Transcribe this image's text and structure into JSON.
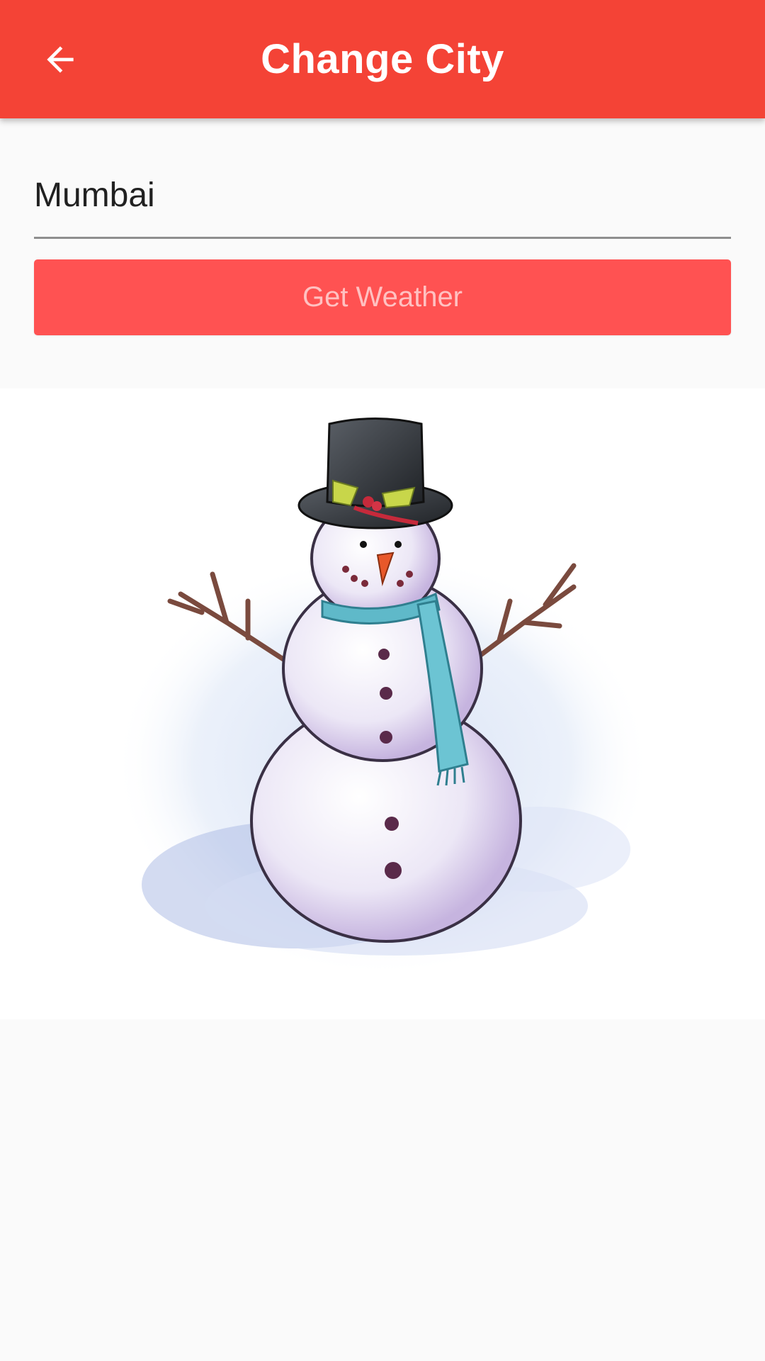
{
  "appbar": {
    "title": "Change City",
    "back_icon": "arrow-back-icon",
    "color": "#f44336"
  },
  "form": {
    "city_value": "Mumbai",
    "button_label": "Get Weather",
    "button_color": "#ff5252"
  },
  "illustration": {
    "subject": "snowman"
  }
}
